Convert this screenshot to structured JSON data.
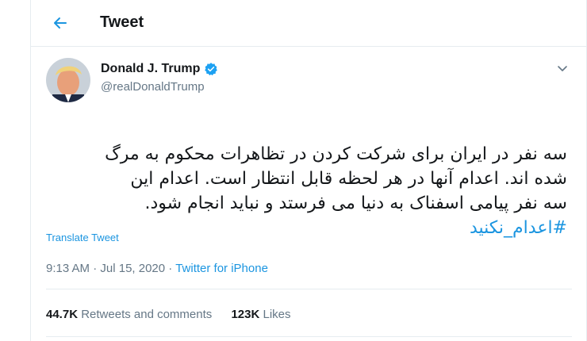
{
  "header": {
    "title": "Tweet",
    "back_icon": "arrow-left-icon"
  },
  "author": {
    "name": "Donald J. Trump",
    "handle": "@realDonaldTrump",
    "verified_icon": "verified-badge-icon"
  },
  "tweet": {
    "text": "سه نفر در ایران برای شرکت کردن در تظاهرات محکوم به مرگ\nشده اند. اعدام آنها در هر لحظه قابل انتظار است. اعدام این\nسه نفر پیامی اسفناک به دنیا می فرستد و نباید انجام شود.",
    "hashtag": "#اعدام_نکنید",
    "translate_label": "Translate Tweet",
    "time": "9:13 AM",
    "date": "Jul 15, 2020",
    "source": "Twitter for iPhone"
  },
  "stats": {
    "retweets_count": "44.7K",
    "retweets_label": "Retweets and comments",
    "likes_count": "123K",
    "likes_label": "Likes"
  },
  "colors": {
    "accent": "#1b95e0",
    "muted": "#657786",
    "text": "#14171a",
    "border": "#e6ecf0"
  }
}
